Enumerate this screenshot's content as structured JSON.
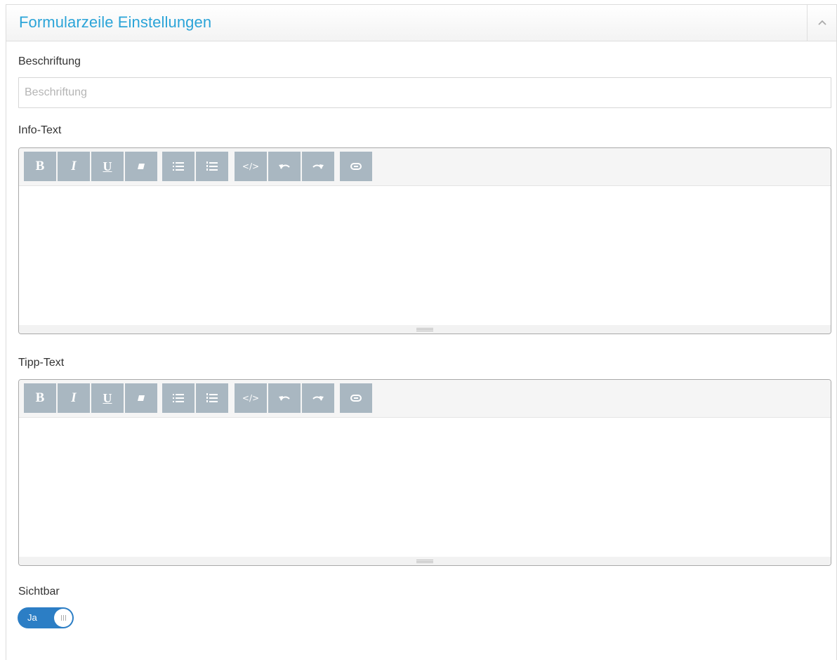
{
  "panel": {
    "title": "Formularzeile Einstellungen",
    "collapse_icon": "chevron-up-icon"
  },
  "fields": {
    "label": {
      "label": "Beschriftung",
      "value": "",
      "placeholder": "Beschriftung"
    },
    "info_text": {
      "label": "Info-Text"
    },
    "tip_text": {
      "label": "Tipp-Text"
    },
    "visible": {
      "label": "Sichtbar",
      "toggle_text": "Ja",
      "checked": true
    }
  },
  "editor_toolbar": {
    "bold": "B",
    "italic": "I",
    "underline": "U",
    "eraser_icon": "eraser-icon",
    "unordered_list_icon": "unordered-list-icon",
    "ordered_list_icon": "ordered-list-icon",
    "code": "</>",
    "undo_icon": "undo-icon",
    "redo_icon": "redo-icon",
    "link_icon": "link-icon"
  },
  "colors": {
    "title": "#2ba4d8",
    "toolbar_button": "#a9b7c1",
    "toggle_on": "#2c7ec5"
  }
}
